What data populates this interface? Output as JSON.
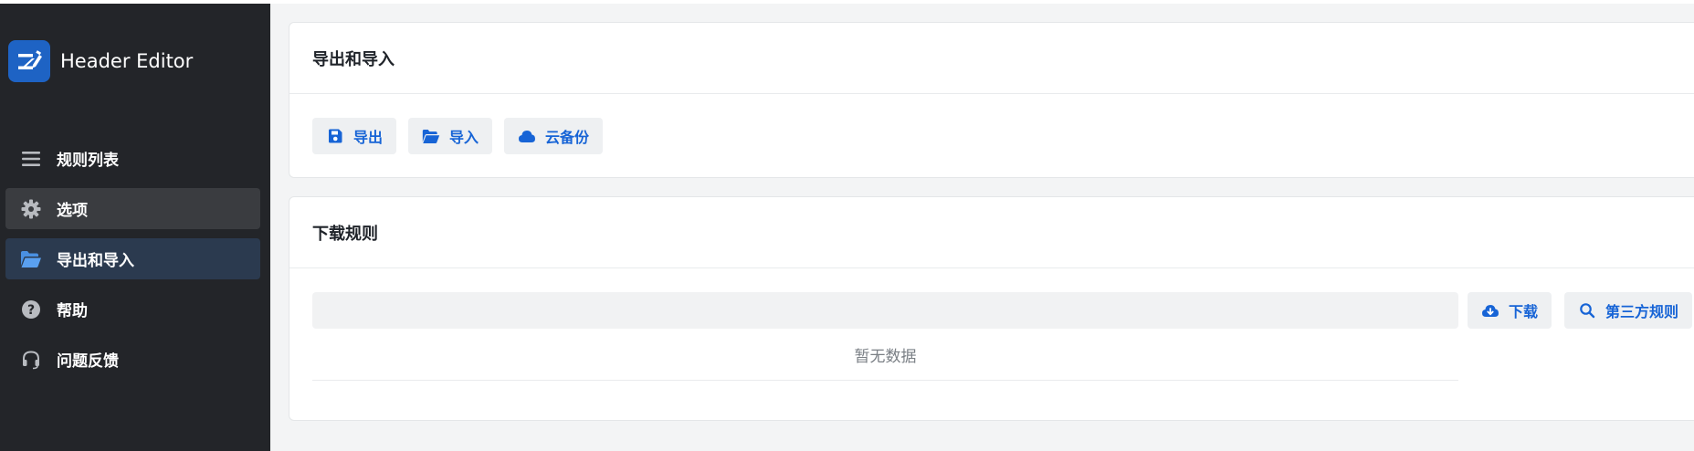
{
  "app": {
    "name": "Header Editor"
  },
  "sidebar": {
    "items": [
      {
        "label": "规则列表",
        "icon": "list-icon"
      },
      {
        "label": "选项",
        "icon": "gear-icon"
      },
      {
        "label": "导出和导入",
        "icon": "folder-open-icon"
      },
      {
        "label": "帮助",
        "icon": "help-circle-icon"
      },
      {
        "label": "问题反馈",
        "icon": "headset-icon"
      }
    ],
    "active_index": 2,
    "hover_index": 1
  },
  "export_import": {
    "title": "导出和导入",
    "buttons": [
      {
        "label": "导出",
        "icon": "save-icon"
      },
      {
        "label": "导入",
        "icon": "folder-open-icon"
      },
      {
        "label": "云备份",
        "icon": "cloud-icon"
      }
    ]
  },
  "download_rules": {
    "title": "下载规则",
    "url_input": {
      "value": "",
      "placeholder": ""
    },
    "download_button": {
      "label": "下载",
      "icon": "cloud-download-icon"
    },
    "third_party_button": {
      "label": "第三方规则",
      "icon": "search-icon"
    },
    "empty_text": "暂无数据"
  },
  "colors": {
    "sidebar_bg": "#232529",
    "active_item_bg": "#2b3a4f",
    "hover_item_bg": "#3a3c40",
    "accent": "#1764d6",
    "logo_bg": "#1e63c4",
    "page_bg": "#f3f4f5"
  }
}
